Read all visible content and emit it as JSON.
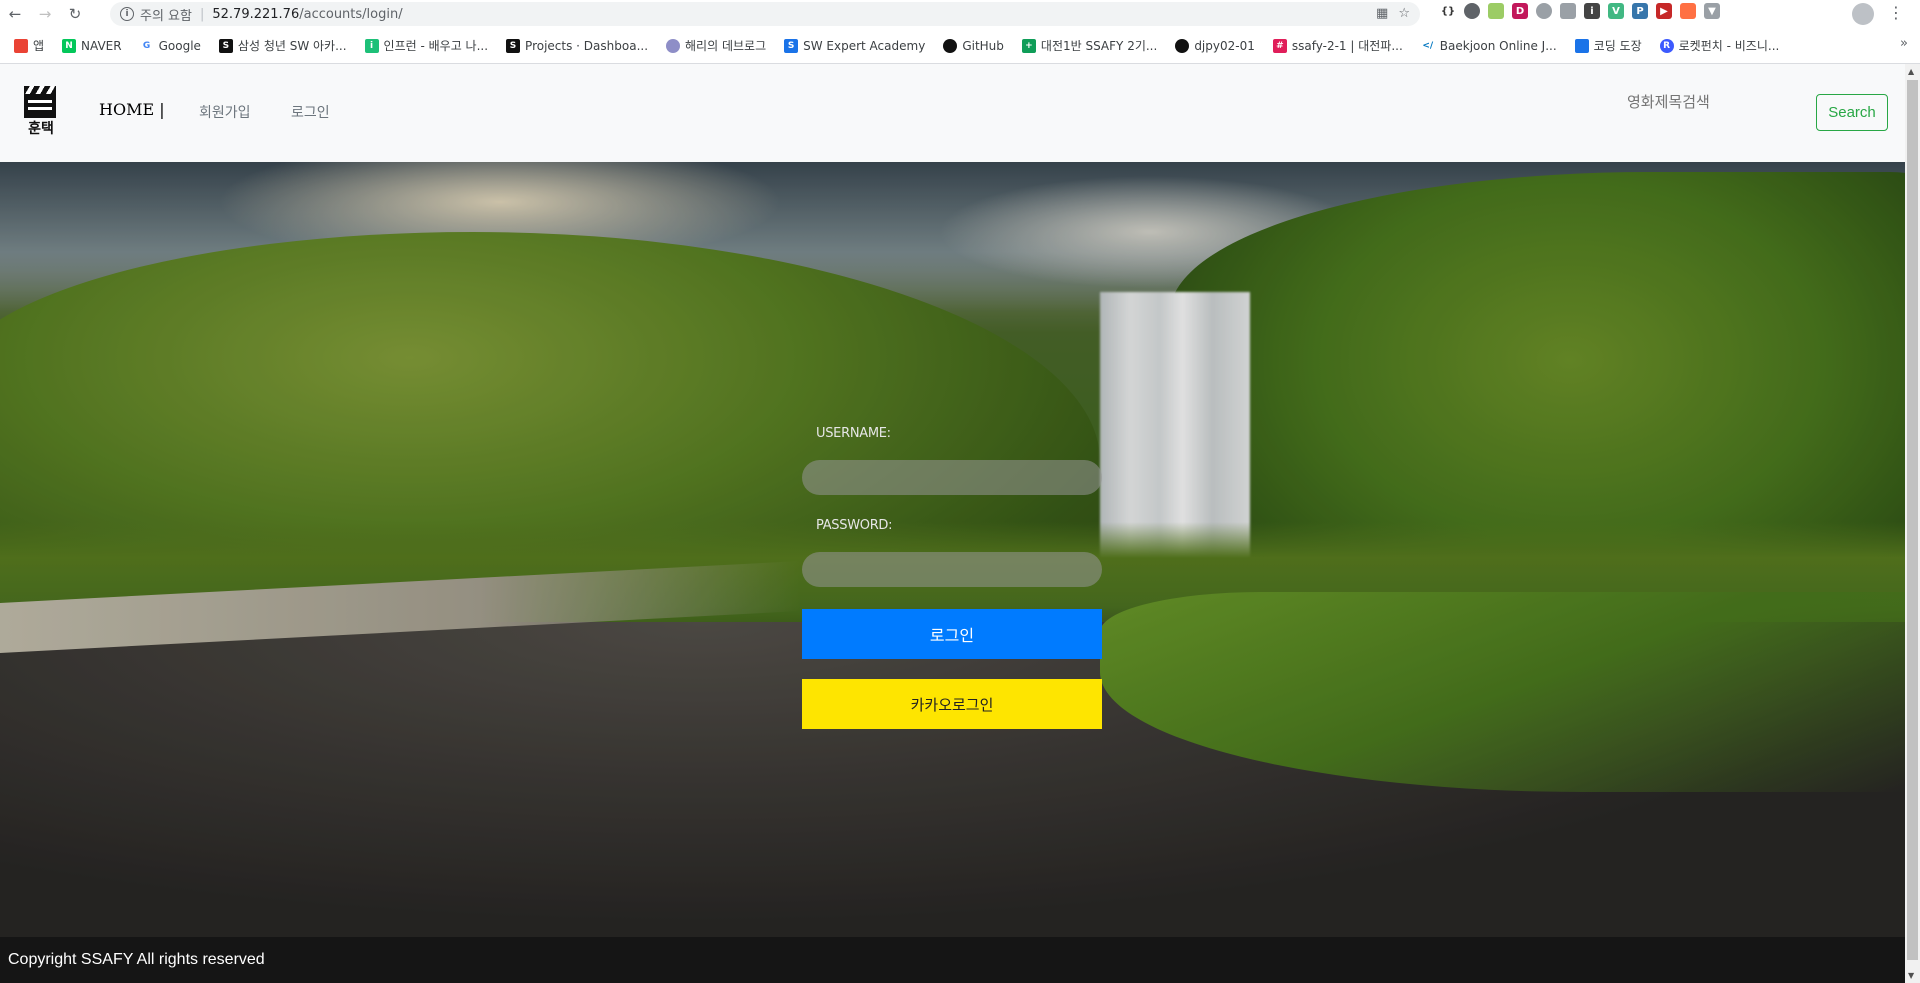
{
  "browser": {
    "security_warning": "주의 요함",
    "url_host": "52.79.221.76",
    "url_path": "/accounts/login/",
    "bookmarks": [
      {
        "label": "앱",
        "icon": "apps-grid-icon",
        "color": "#ea4335"
      },
      {
        "label": "NAVER",
        "icon": "naver-icon",
        "color": "#03c75a"
      },
      {
        "label": "Google",
        "icon": "google-icon",
        "color": "#4285f4"
      },
      {
        "label": "삼성 청년 SW 아카...",
        "icon": "samsung-icon",
        "color": "#111111"
      },
      {
        "label": "인프런 - 배우고 나...",
        "icon": "inflearn-icon",
        "color": "#1dc078"
      },
      {
        "label": "Projects · Dashboa...",
        "icon": "gitlab-icon",
        "color": "#111111"
      },
      {
        "label": "해리의 데브로그",
        "icon": "blog-icon",
        "color": "#8e8ec7"
      },
      {
        "label": "SW Expert Academy",
        "icon": "swea-icon",
        "color": "#1a73e8"
      },
      {
        "label": "GitHub",
        "icon": "github-icon",
        "color": "#111111"
      },
      {
        "label": "대전1반 SSAFY 2기...",
        "icon": "sheets-icon",
        "color": "#0f9d58"
      },
      {
        "label": "djpy02-01",
        "icon": "github-icon",
        "color": "#111111"
      },
      {
        "label": "ssafy-2-1 | 대전파...",
        "icon": "slack-icon",
        "color": "#e01e5a"
      },
      {
        "label": "Baekjoon Online J...",
        "icon": "code-icon",
        "color": "#0076c0"
      },
      {
        "label": "코딩 도장",
        "icon": "dojang-icon",
        "color": "#1a73e8"
      },
      {
        "label": "로켓펀치 - 비즈니...",
        "icon": "rocketpunch-icon",
        "color": "#3d5afe"
      }
    ]
  },
  "site": {
    "logo_text": "훈택",
    "nav": {
      "home": "HOME |",
      "signup": "회원가입",
      "login": "로그인"
    },
    "search": {
      "placeholder": "영화제목검색",
      "button": "Search"
    }
  },
  "login": {
    "username_label": "USERNAME:",
    "password_label": "PASSWORD:",
    "username_value": "",
    "password_value": "",
    "submit": "로그인",
    "kakao": "카카오로그인"
  },
  "footer": {
    "copyright": "Copyright SSAFY All rights reserved"
  },
  "colors": {
    "login_button": "#007bff",
    "kakao_button": "#fee500",
    "search_button": "#28a745"
  }
}
